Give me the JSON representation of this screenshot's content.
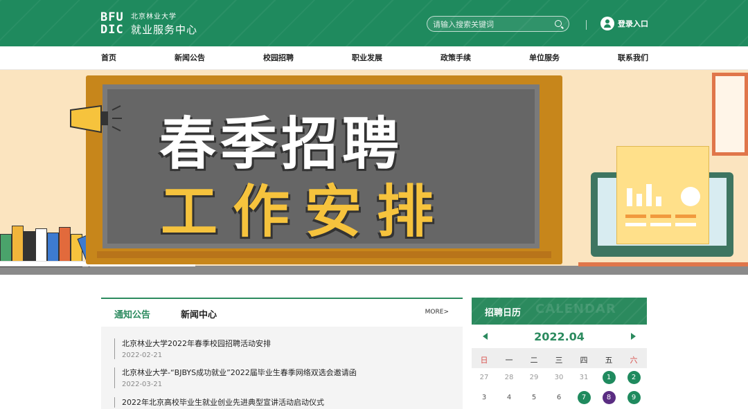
{
  "header": {
    "logo_mark": "BFU DIC",
    "university": "北京林业大学",
    "center": "就业服务中心",
    "search_placeholder": "请输入搜索关键词",
    "login_label": "登录入口"
  },
  "nav": {
    "items": [
      {
        "label": "首页"
      },
      {
        "label": "新闻公告"
      },
      {
        "label": "校园招聘"
      },
      {
        "label": "职业发展"
      },
      {
        "label": "政策手续"
      },
      {
        "label": "单位服务"
      },
      {
        "label": "联系我们"
      }
    ]
  },
  "banner": {
    "line1": "春季招聘",
    "line2": "工作安排",
    "slide_count": 5,
    "active_slide": 1
  },
  "news": {
    "tabs": [
      {
        "label": "通知公告",
        "active": true
      },
      {
        "label": "新闻中心",
        "active": false
      }
    ],
    "more_label": "MORE>",
    "items": [
      {
        "title": "北京林业大学2022年春季校园招聘活动安排",
        "date": "2022-02-21"
      },
      {
        "title": "北京林业大学-“BJBYS成功就业”2022届毕业生春季网络双选会邀请函",
        "date": "2022-03-21"
      },
      {
        "title": "2022年北京高校毕业生就业创业先进典型宣讲活动启动仪式",
        "date": ""
      }
    ]
  },
  "calendar": {
    "title": "招聘日历",
    "watermark": "CALENDAR",
    "month": "2022.04",
    "weekdays": [
      "日",
      "一",
      "二",
      "三",
      "四",
      "五",
      "六"
    ],
    "rows": [
      [
        {
          "d": "27",
          "faded": true
        },
        {
          "d": "28",
          "faded": true
        },
        {
          "d": "29",
          "faded": true
        },
        {
          "d": "30",
          "faded": true
        },
        {
          "d": "31",
          "faded": true
        },
        {
          "d": "1",
          "mark": "#1f8a5e"
        },
        {
          "d": "2",
          "mark": "#1f8a5e"
        }
      ],
      [
        {
          "d": "3"
        },
        {
          "d": "4"
        },
        {
          "d": "5"
        },
        {
          "d": "6"
        },
        {
          "d": "7",
          "mark": "#1f8a5e"
        },
        {
          "d": "8",
          "mark": "#5a2d82"
        },
        {
          "d": "9",
          "mark": "#1f8a5e"
        }
      ]
    ]
  },
  "colors": {
    "brand_green": "#1f8a5e",
    "accent_purple": "#5a2d82",
    "headline_yellow": "#f6c33d"
  }
}
